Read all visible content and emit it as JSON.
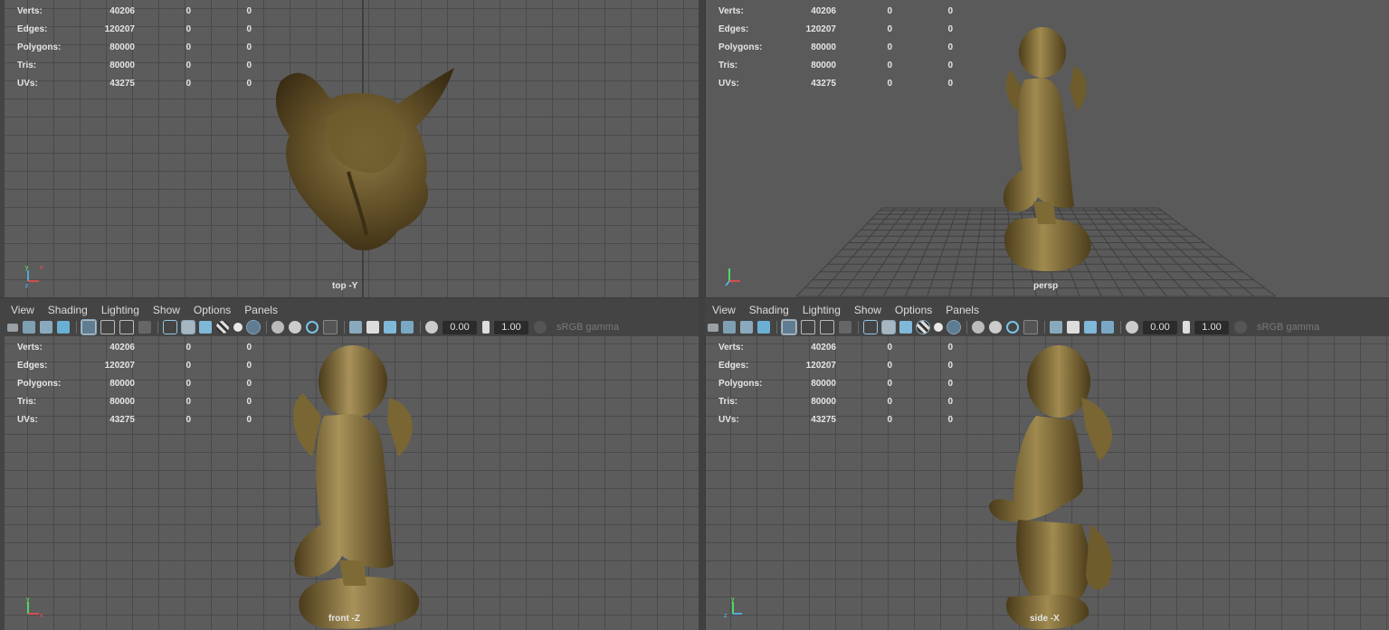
{
  "hud_labels": [
    "Verts:",
    "Edges:",
    "Polygons:",
    "Tris:",
    "UVs:"
  ],
  "hud_values": {
    "verts": [
      "40206",
      "0",
      "0"
    ],
    "edges": [
      "120207",
      "0",
      "0"
    ],
    "polygons": [
      "80000",
      "0",
      "0"
    ],
    "tris": [
      "80000",
      "0",
      "0"
    ],
    "uvs": [
      "43275",
      "0",
      "0"
    ]
  },
  "cameras": {
    "top": "top -Y",
    "persp": "persp",
    "front": "front -Z",
    "side": "side -X"
  },
  "menu": [
    "View",
    "Shading",
    "Lighting",
    "Show",
    "Options",
    "Panels"
  ],
  "toolbar": {
    "exposure": "0.00",
    "gamma": "1.00",
    "color_space": "sRGB gamma"
  },
  "icons": {
    "camera": "camera-icon",
    "wireframe": "wireframe-icon",
    "smooth_shade": "smooth-shade-icon",
    "textured": "textured-icon",
    "lights": "lights-icon",
    "isolate": "isolate-select-icon",
    "exposure": "exposure-icon",
    "gamma": "gamma-icon"
  },
  "colors": {
    "viewport_bg": "#5c5c5c",
    "grid_line": "#4a4a4a",
    "panel_bg": "#444444",
    "active_tool": "#5e7d92",
    "statue_bronze": "#8a7438"
  }
}
